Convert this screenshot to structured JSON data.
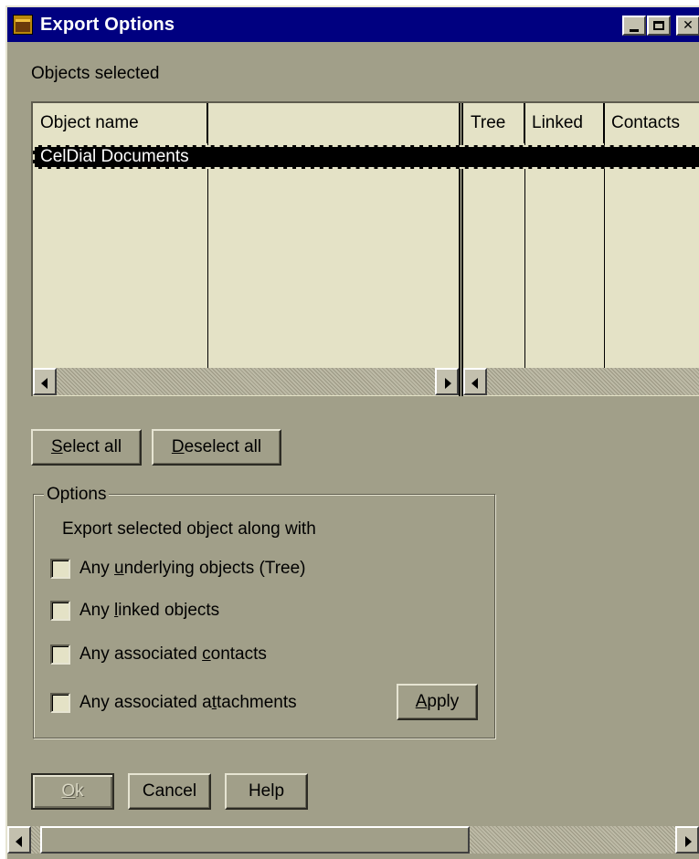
{
  "window": {
    "title": "Export Options"
  },
  "objects": {
    "label": "Objects selected",
    "columns": [
      "Object name",
      "",
      "Tree",
      "Linked",
      "Contacts"
    ],
    "rows": [
      {
        "name": "CelDial Documents"
      }
    ]
  },
  "selection_buttons": {
    "select_all": {
      "prefix": "",
      "accel": "S",
      "rest": "elect all"
    },
    "deselect_all": {
      "prefix": "",
      "accel": "D",
      "rest": "eselect all"
    }
  },
  "options": {
    "title": "Options",
    "subtitle": "Export selected object along with",
    "items": [
      {
        "before": "Any ",
        "accel": "u",
        "after": "nderlying objects (Tree)",
        "checked": false
      },
      {
        "before": "Any ",
        "accel": "l",
        "after": "inked objects",
        "checked": false
      },
      {
        "before": "Any associated ",
        "accel": "c",
        "after": "ontacts",
        "checked": false
      },
      {
        "before": "Any associated a",
        "accel": "t",
        "after": "tachments",
        "checked": false
      }
    ],
    "apply": {
      "prefix": "",
      "accel": "A",
      "rest": "pply"
    }
  },
  "footer": {
    "ok": {
      "prefix": "",
      "accel": "O",
      "rest": "k"
    },
    "cancel": "Cancel",
    "help": "Help"
  }
}
